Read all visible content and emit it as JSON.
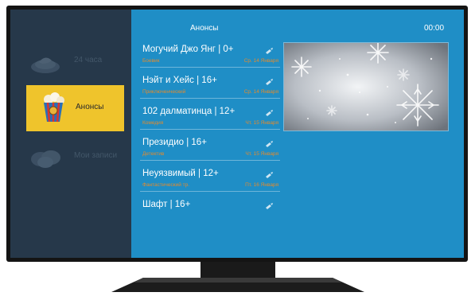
{
  "header": {
    "title": "Анонсы",
    "time": "00:00"
  },
  "sidebar": {
    "items": [
      {
        "label": "24 часа",
        "icon": "plate-icon",
        "active": false
      },
      {
        "label": "Анонсы",
        "icon": "popcorn-icon",
        "active": true
      },
      {
        "label": "Мои записи",
        "icon": "film-reels-icon",
        "active": false
      }
    ]
  },
  "list": {
    "items": [
      {
        "title": "Могучий Джо Янг | 0+",
        "genre": "Боевик",
        "date": "Ср. 14 Января"
      },
      {
        "title": "Нэйт и Хейс | 16+",
        "genre": "Приключенческий",
        "date": "Ср. 14 Января"
      },
      {
        "title": "102 далматинца | 12+",
        "genre": "Комедия",
        "date": "Чт. 15 Января"
      },
      {
        "title": "Президио | 16+",
        "genre": "Детектив",
        "date": "Чт. 15 Января"
      },
      {
        "title": "Неуязвимый | 12+",
        "genre": "Фантастический тр.",
        "date": "Пт. 16 Января"
      },
      {
        "title": "Шафт | 16+",
        "genre": "",
        "date": ""
      }
    ]
  },
  "colors": {
    "screen_bg": "#1f8ec6",
    "sidebar_bg": "#26384a",
    "active_tile": "#efc42c",
    "subtitle": "#e58a2c"
  }
}
